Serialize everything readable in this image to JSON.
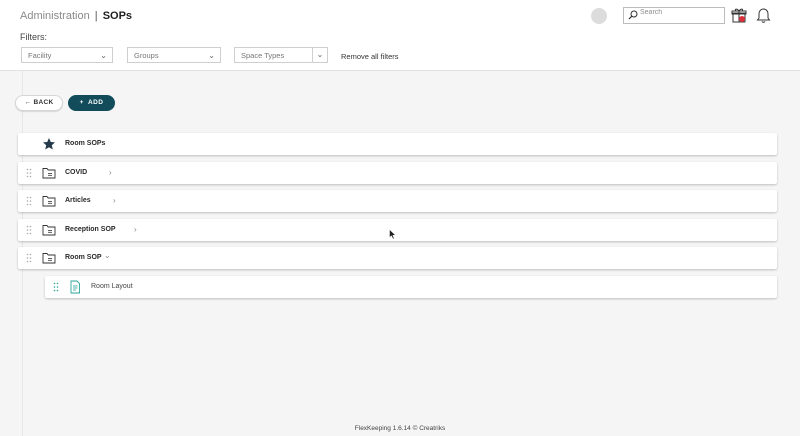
{
  "header": {
    "breadcrumb": "Administration",
    "separator": "|",
    "page_title": "SOPs",
    "search_placeholder": "Search"
  },
  "filters": {
    "label": "Filters:",
    "facility": "Facility",
    "groups": "Groups",
    "space_types": "Space Types",
    "remove_all": "Remove all filters"
  },
  "actions": {
    "back": "BACK",
    "add": "ADD"
  },
  "rows": [
    {
      "label": "Room SOPs",
      "icon": "star-icon",
      "expandable": false
    },
    {
      "label": "COVID",
      "icon": "folder-icon",
      "expandable": true,
      "expanded": false
    },
    {
      "label": "Articles",
      "icon": "folder-icon",
      "expandable": true,
      "expanded": false
    },
    {
      "label": "Reception SOP",
      "icon": "folder-icon",
      "expandable": true,
      "expanded": false
    },
    {
      "label": "Room SOP",
      "icon": "folder-icon",
      "expandable": true,
      "expanded": true
    }
  ],
  "children": [
    {
      "label": "Room Layout",
      "icon": "document-icon"
    }
  ],
  "footer": "FlexKeeping 1.6.14 © Creatriks",
  "colors": {
    "primary": "#124c5a",
    "badge": "#d9323a",
    "doc_icon": "#2aa39a"
  }
}
